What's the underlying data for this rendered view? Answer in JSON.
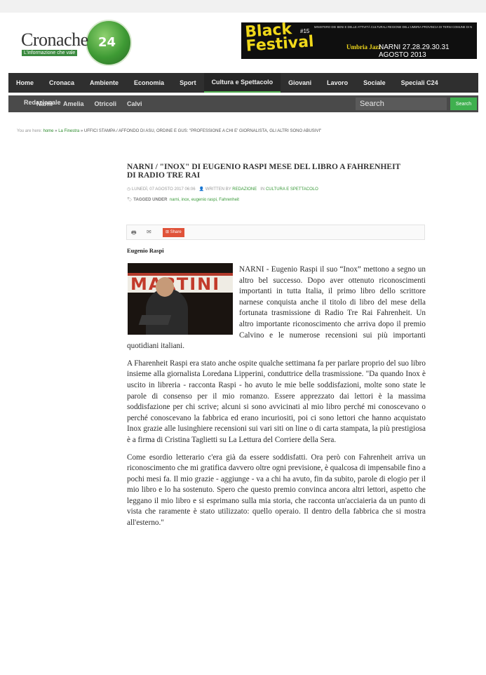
{
  "header": {
    "logo_text": "Cronache",
    "logo_badge": "24",
    "logo_tagline": "L'informazione che vale",
    "banner": {
      "title": "Black Festival",
      "edition": "#15",
      "sponsors": "MINISTERO DEI BENI E DELLE ATTIVITÀ CULTURALI  REGIONE DELL'UMBRIA  PROVINCIA DI TERNI  COMUNE DI NARNI",
      "partner": "Umbria Jazz",
      "dates": "NARNI 27.28.29.30.31 AGOSTO 2013"
    }
  },
  "nav": {
    "primary": [
      "Home",
      "Cronaca",
      "Ambiente",
      "Economia",
      "Sport",
      "Cultura e Spettacolo",
      "Giovani",
      "Lavoro",
      "Sociale",
      "Speciali C24"
    ],
    "active_index": 5,
    "secondary_overlap": "Redazionale",
    "secondary": [
      "Narni",
      "Amelia",
      "Otricoli",
      "Calvi"
    ],
    "search_placeholder": "Search",
    "search_button": "Search"
  },
  "breadcrumb": {
    "prefix": "You are here:",
    "home": "home",
    "sep": "»",
    "section": "La Finestra",
    "current": "UFFICI STAMPA / AFFONDO DI ASU, ORDINE E GUS: \"PROFESSIONE A CHI E' GIORNALISTA, GLI ALTRI SONO ABUSIVI\""
  },
  "article": {
    "title": "NARNI / \"INOX\" DI EUGENIO RASPI MESE DEL LIBRO A FAHRENHEIT DI RADIO TRE RAI",
    "date": "LUNEDÌ, 07 AGOSTO 2017 06:06",
    "written_by_label": "WRITTEN BY",
    "author_link": "REDAZIONE",
    "in_label": "IN",
    "category": "CULTURA E SPETTACOLO",
    "tagged_label": "TAGGED UNDER",
    "tags": "narni,  inox,  eugenio raspi,  Fahrenheit",
    "share_label": "Share",
    "photo_sign": "MARTINI",
    "author": "Eugenio Raspi",
    "paragraphs": [
      "NARNI - Eugenio Raspi il suo “Inox” mettono a segno un altro bel successo. Dopo aver ottenuto riconoscimenti importanti in tutta Italia, il primo libro dello scrittore narnese conquista anche il titolo di libro del mese della fortunata trasmissione di Radio Tre Rai Fahrenheit. Un altro importante riconoscimento che arriva dopo il premio Calvino e le numerose recensioni sui più importanti quotidiani italiani.",
      "A Fharenheit Raspi era stato anche ospite qualche settimana fa per parlare proprio del suo libro insieme alla giornalista Loredana Lipperini, conduttrice della trasmissione. \"Da quando Inox è uscito in libreria - racconta Raspi - ho avuto le mie belle soddisfazioni, molte sono state le parole di consenso per il mio romanzo. Essere apprezzato dai lettori è la massima soddisfazione per chi scrive; alcuni si sono avvicinati al mio libro perché mi conoscevano o perché conoscevano la fabbrica ed erano incuriositi, poi ci sono lettori che hanno acquistato Inox grazie alle lusinghiere recensioni sui vari siti on line o di carta stampata, la più prestigiosa è a firma di Cristina Taglietti su La Lettura del Corriere della Sera.",
      "Come esordio letterario c'era già da essere soddisfatti. Ora però con Fahrenheit arriva un riconoscimento che mi gratifica davvero oltre ogni previsione, è qualcosa di impensabile fino a pochi mesi fa. Il mio grazie - aggiunge - va a chi ha avuto, fin da subito, parole di elogio per il mio libro e lo ha sostenuto. Spero che questo premio convinca ancora altri lettori, aspetto che leggano il mio libro e si esprimano sulla mia storia, che racconta un'acciaieria da un punto di vista che raramente è stato utilizzato: quello operaio. Il dentro della fabbrica che si mostra all'esterno.\""
    ]
  }
}
